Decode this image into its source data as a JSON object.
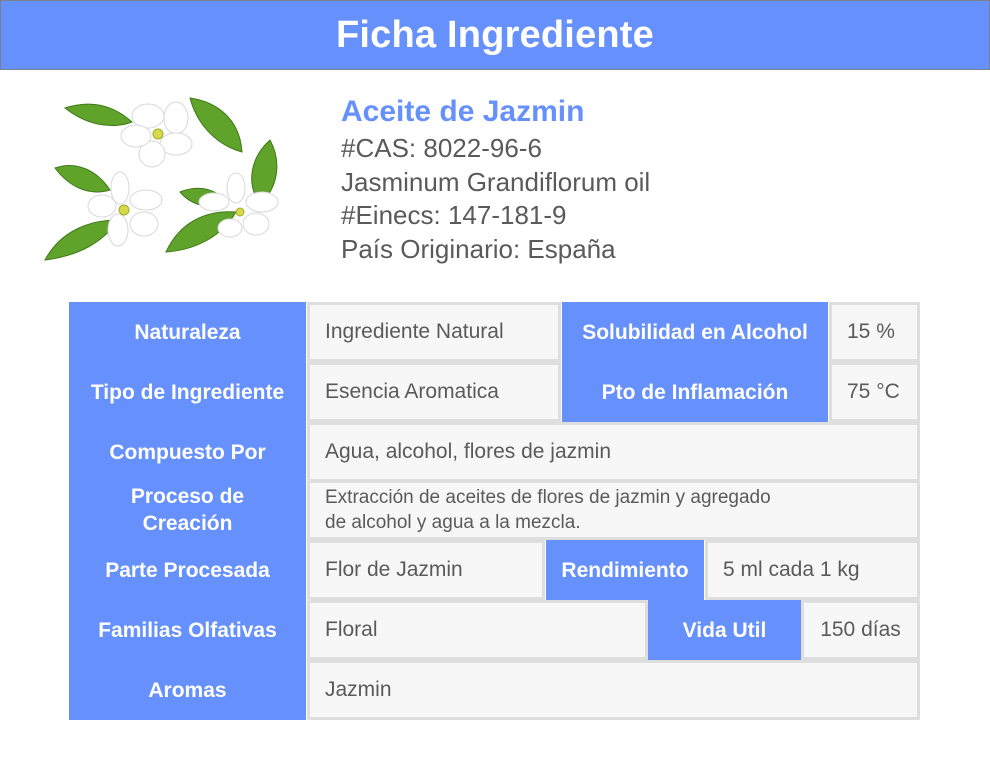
{
  "header": {
    "title": "Ficha Ingrediente"
  },
  "ingredient": {
    "name": "Aceite de Jazmin",
    "cas": "#CAS: 8022-96-6",
    "inci": "Jasminum Grandiflorum oil",
    "einecs": "#Einecs: 147-181-9",
    "origin": "País Originario: España"
  },
  "image": {
    "icon": "jasmine-flower-icon",
    "description_colors": {
      "petal": "#ffffff",
      "leaf": "#5fa32a",
      "center": "#d9d74a"
    }
  },
  "colors": {
    "accent": "#6690fc",
    "value_bg": "#f7f7f7",
    "value_border": "#dedede",
    "text": "#5a5a5a"
  },
  "table": {
    "naturaleza": {
      "label": "Naturaleza",
      "value": "Ingrediente Natural"
    },
    "solubilidad": {
      "label": "Solubilidad en Alcohol",
      "value": "15 %"
    },
    "tipo": {
      "label": "Tipo de Ingrediente",
      "value": "Esencia Aromatica"
    },
    "inflamacion": {
      "label": "Pto de Inflamación",
      "value": "75 °C"
    },
    "compuesto": {
      "label": "Compuesto Por",
      "value": "Agua, alcohol, flores de jazmin"
    },
    "proceso": {
      "label_line1": "Proceso de",
      "label_line2": "Creación",
      "value_line1": "Extracción de aceites de flores de jazmin y agregado",
      "value_line2": "de alcohol y agua a la mezcla."
    },
    "parte": {
      "label": "Parte Procesada",
      "value": "Flor de Jazmin"
    },
    "rendimiento": {
      "label": "Rendimiento",
      "value": "5 ml cada 1 kg"
    },
    "familias": {
      "label": "Familias Olfativas",
      "value": "Floral"
    },
    "vida": {
      "label": "Vida Util",
      "value": "150 días"
    },
    "aromas": {
      "label": "Aromas",
      "value": "Jazmin"
    }
  }
}
